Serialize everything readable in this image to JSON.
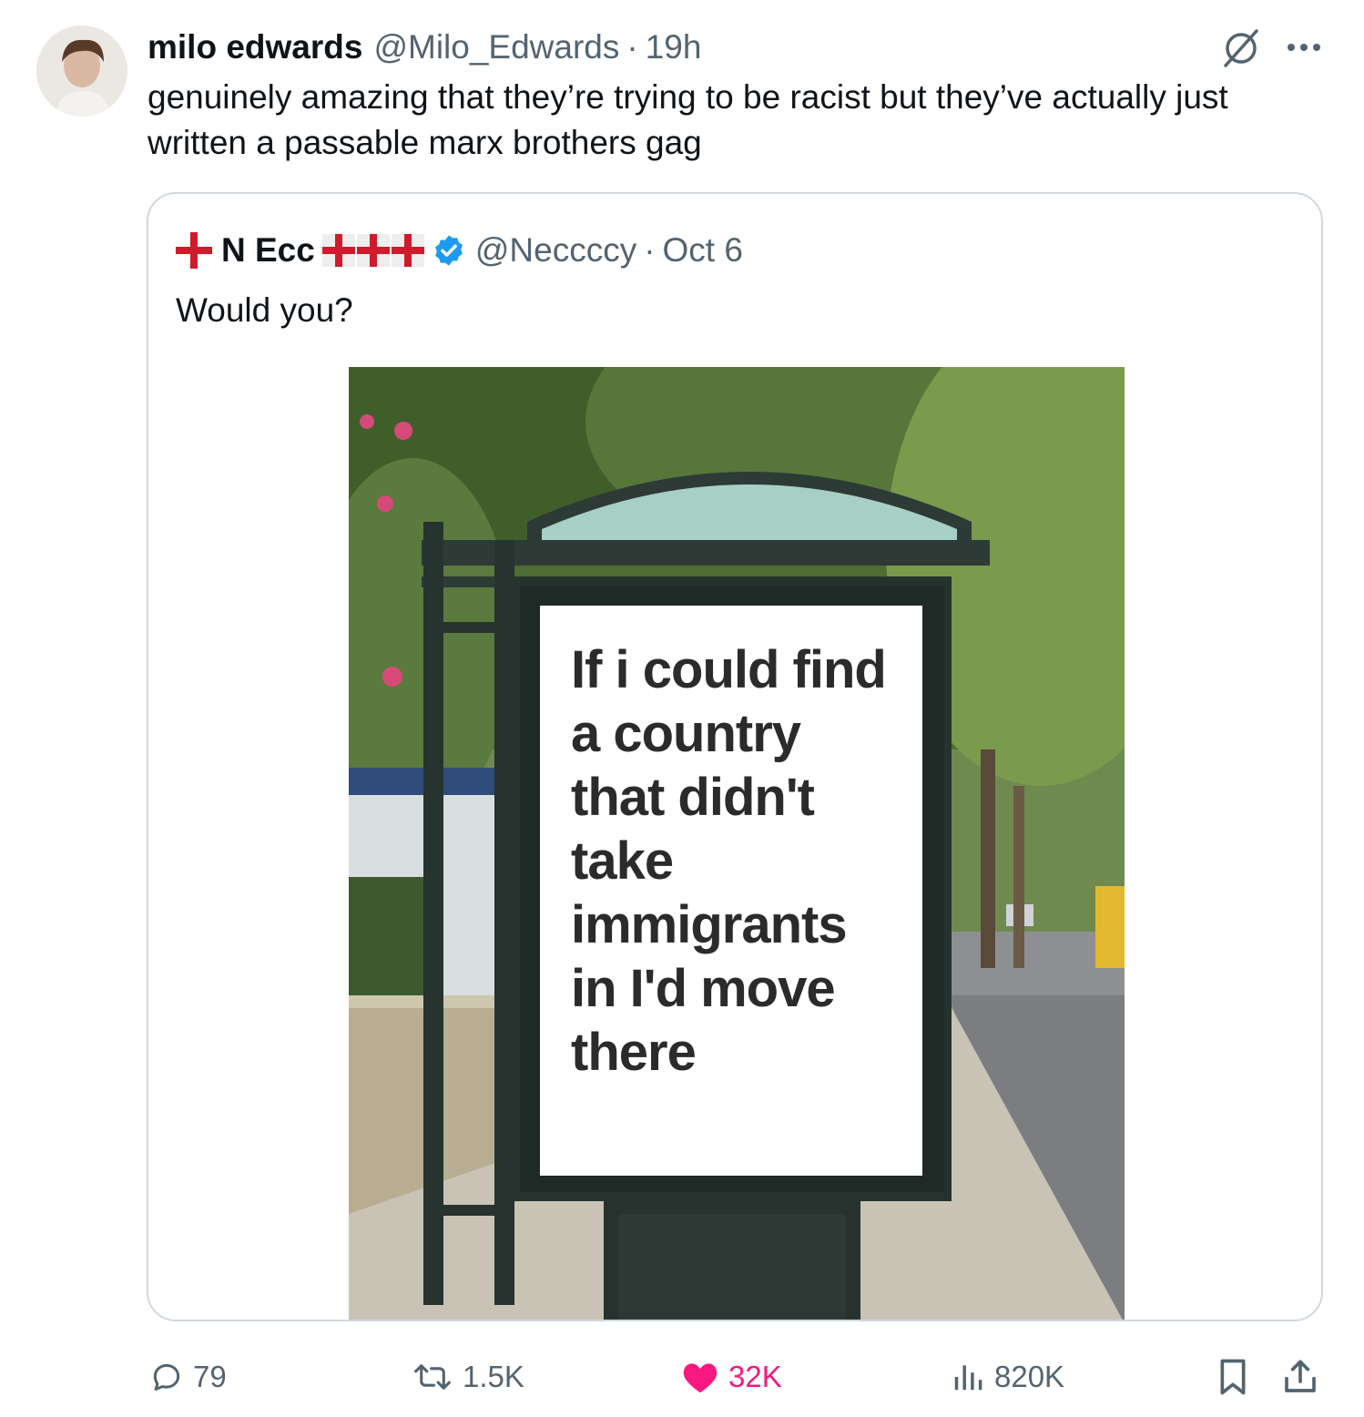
{
  "tweet": {
    "author_name": "milo edwards",
    "author_handle": "@Milo_Edwards",
    "separator": "·",
    "time": "19h",
    "text": "genuinely amazing that they’re trying to be racist but they’ve actually just written a passable marx brothers gag"
  },
  "quoted": {
    "author_name": "N Ecc",
    "author_handle": "@Neccccy",
    "separator": "·",
    "date": "Oct 6",
    "text": "Would you?",
    "billboard_text": "If i could find a country that didn't take immigrants in I'd move there"
  },
  "actions": {
    "replies": "79",
    "reposts": "1.5K",
    "likes": "32K",
    "views": "820K"
  },
  "icons": {
    "header": [
      "grok-icon",
      "more-icon"
    ],
    "actions": [
      "reply-icon",
      "repost-icon",
      "heart-icon",
      "views-icon",
      "bookmark-icon",
      "share-icon"
    ]
  },
  "colors": {
    "text": "#0f1419",
    "secondary": "#536471",
    "border": "#cfd9de",
    "like": "#f91880",
    "verified": "#1d9bf0",
    "flag_red": "#cf1b2b"
  }
}
